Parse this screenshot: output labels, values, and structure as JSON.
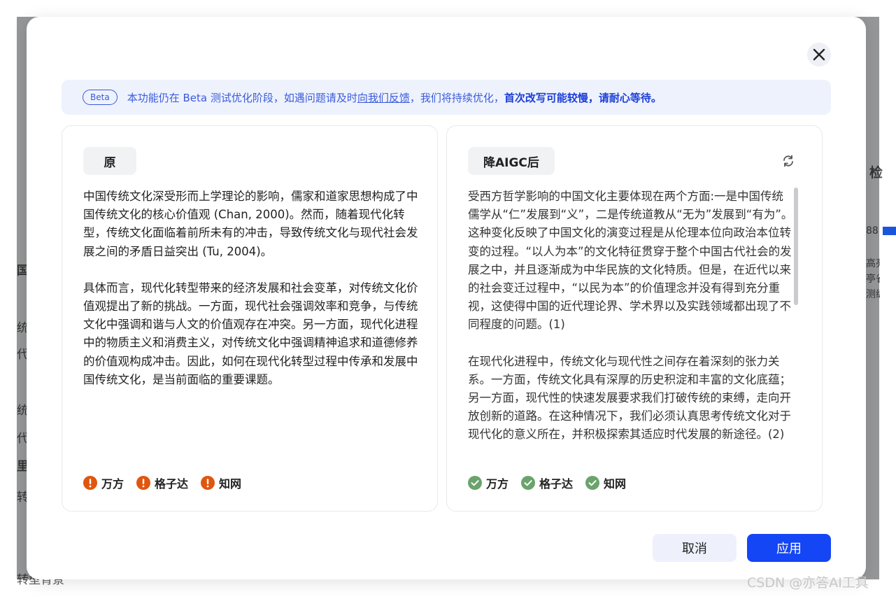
{
  "background": {
    "fragments": [
      "检",
      "88",
      "高亮",
      "亭省",
      "测编",
      "国作",
      "统",
      "代",
      "统",
      "代",
      "里",
      "转",
      "转型背景"
    ]
  },
  "banner": {
    "badge": "Beta",
    "text_before": "本功能仍在 Beta 测试优化阶段，如遇问题请及时",
    "link": "向我们反馈",
    "text_after": "，我们将持续优化，",
    "emphasis": "首次改写可能较慢，请耐心等待。"
  },
  "original": {
    "tag": "原",
    "paragraphs": [
      "中国传统文化深受形而上学理论的影响，儒家和道家思想构成了中国传统文化的核心价值观 (Chan, 2000)。然而，随着现代化转型，传统文化面临着前所未有的冲击，导致传统文化与现代社会发展之间的矛盾日益突出 (Tu, 2004)。",
      "具体而言，现代化转型带来的经济发展和社会变革，对传统文化价值观提出了新的挑战。一方面，现代社会强调效率和竞争，与传统文化中强调和谐与人文的价值观存在冲突。另一方面，现代化进程中的物质主义和消费主义，对传统文化中强调精神追求和道德修养的价值观构成冲击。因此，如何在现代化转型过程中传承和发展中国传统文化，是当前面临的重要课题。"
    ],
    "checks": [
      {
        "label": "万方",
        "status": "warning"
      },
      {
        "label": "格子达",
        "status": "warning"
      },
      {
        "label": "知网",
        "status": "warning"
      }
    ]
  },
  "rewritten": {
    "tag": "降AIGC后",
    "paragraphs": [
      "受西方哲学影响的中国文化主要体现在两个方面:一是中国传统儒学从“仁”发展到“义”，二是传统道教从“无为”发展到“有为”。这种变化反映了中国文化的演变过程是从伦理本位向政治本位转变的过程。“以人为本”的文化特征贯穿于整个中国古代社会的发展之中，并且逐渐成为中华民族的文化特质。但是，在近代以来的社会变迁过程中，“以民为本”的价值理念并没有得到充分重视，这使得中国的近代理论界、学术界以及实践领域都出现了不同程度的问题。(1)",
      "在现代化进程中，传统文化与现代性之间存在着深刻的张力关系。一方面，传统文化具有深厚的历史积淀和丰富的文化底蕴；另一方面，现代性的快速发展要求我们打破传统的束缚，走向开放创新的道路。在这种情况下，我们必须认真思考传统文化对于现代化的意义所在，并积极探索其适应时代发展的新途径。(2)"
    ],
    "checks": [
      {
        "label": "万方",
        "status": "pass"
      },
      {
        "label": "格子达",
        "status": "pass"
      },
      {
        "label": "知网",
        "status": "pass"
      }
    ]
  },
  "actions": {
    "cancel": "取消",
    "apply": "应用"
  },
  "watermark": "CSDN @亦答AI工具",
  "colors": {
    "accent": "#1546f5",
    "warning": "#e0560f",
    "pass": "#6aa36c",
    "banner_bg": "#eef2fd"
  }
}
